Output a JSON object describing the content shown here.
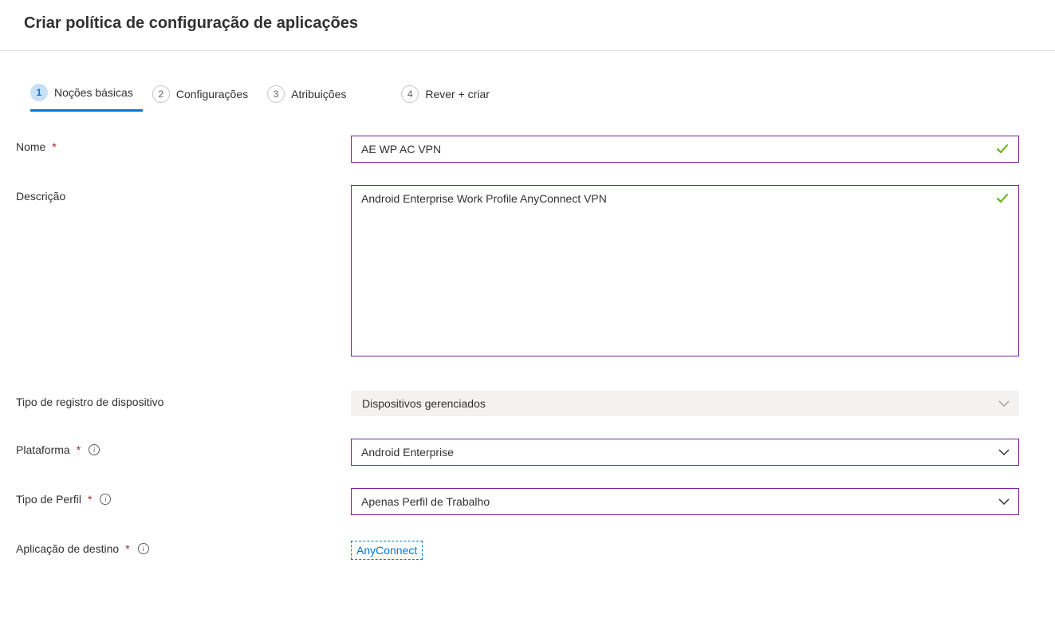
{
  "header": {
    "title": "Criar política de configuração de aplicações"
  },
  "tabs": [
    {
      "num": "1",
      "label": "Noções básicas",
      "active": true
    },
    {
      "num": "2",
      "label": "Configurações",
      "active": false
    },
    {
      "num": "3",
      "label": "Atribuições",
      "active": false
    },
    {
      "num": "4",
      "label": "Rever + criar",
      "active": false
    }
  ],
  "fields": {
    "name": {
      "label": "Nome",
      "value": "AE WP AC VPN"
    },
    "description": {
      "label": "Descrição",
      "value": "Android Enterprise Work Profile AnyConnect VPN"
    },
    "enrollment_type": {
      "label": "Tipo de registro de dispositivo",
      "value": "Dispositivos gerenciados"
    },
    "platform": {
      "label": "Plataforma",
      "value": "Android Enterprise"
    },
    "profile_type": {
      "label": "Tipo de Perfil",
      "value": "Apenas Perfil de Trabalho"
    },
    "target_app": {
      "label": "Aplicação de destino",
      "value": "AnyConnect"
    }
  }
}
